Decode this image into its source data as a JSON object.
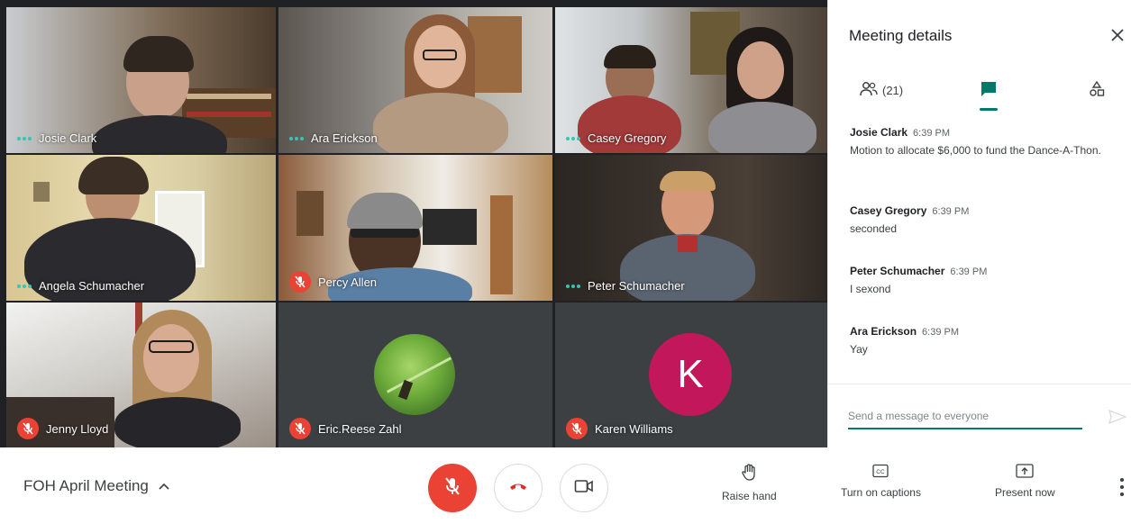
{
  "grid": {
    "tiles": [
      {
        "name": "Josie Clark",
        "indicator": "speaking"
      },
      {
        "name": "Ara Erickson",
        "indicator": "speaking"
      },
      {
        "name": "Casey Gregory",
        "indicator": "speaking"
      },
      {
        "name": "Angela Schumacher",
        "indicator": "speaking"
      },
      {
        "name": "Percy Allen",
        "indicator": "muted"
      },
      {
        "name": "Peter Schumacher",
        "indicator": "speaking"
      },
      {
        "name": "Jenny Lloyd",
        "indicator": "muted"
      },
      {
        "name": "Eric.Reese Zahl",
        "indicator": "muted"
      },
      {
        "name": "Karen Williams",
        "indicator": "muted",
        "avatar_letter": "K",
        "avatar_color": "#c2185b"
      }
    ]
  },
  "panel": {
    "title": "Meeting details",
    "people_count": "(21)",
    "active_tab": "chat",
    "messages": [
      {
        "sender": "Josie Clark",
        "time": "6:39 PM",
        "text": "Motion to allocate $6,000 to fund the Dance-A-Thon."
      },
      {
        "sender": "Casey Gregory",
        "time": "6:39 PM",
        "text": "seconded"
      },
      {
        "sender": "Peter Schumacher",
        "time": "6:39 PM",
        "text": "I sexond"
      },
      {
        "sender": "Ara Erickson",
        "time": "6:39 PM",
        "text": "Yay"
      }
    ],
    "compose_placeholder": "Send a message to everyone"
  },
  "bar": {
    "meeting_title": "FOH April Meeting",
    "actions": {
      "raise_hand": "Raise hand",
      "captions": "Turn on captions",
      "present": "Present now"
    }
  },
  "colors": {
    "accent": "#00796b",
    "danger": "#ea4335",
    "speaking_dots": "#34c6b0"
  }
}
